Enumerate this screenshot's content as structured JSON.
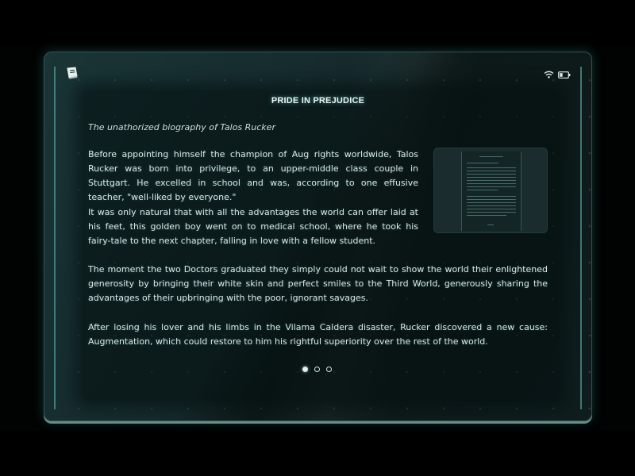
{
  "book": {
    "title": "PRIDE IN PREJUDICE",
    "subtitle": "The unathorized biography of Talos Rucker",
    "paragraphs": [
      "Before appointing himself the champion of Aug rights worldwide, Talos Rucker was born into privilege, to an upper-middle class couple in Stuttgart. He excelled in school and was, according to one effusive teacher, \"well-liked by everyone.\"",
      "It was only natural that with all the advantages the world can offer laid at his feet, this golden boy went on to medical school, where he took his fairy-tale to the next chapter, falling in love with a fellow student.",
      "The moment the two Doctors graduated they simply could not wait to show the world their enlightened generosity by bringing their white skin and perfect smiles to the Third World, generously sharing the advantages of their upbringing with the poor, ignorant savages.",
      "After losing his lover and his limbs in the Vilama Caldera disaster, Rucker discovered a new cause: Augmentation, which could restore to him his rightful superiority over the rest of the world."
    ]
  },
  "status_bar": {
    "icons": [
      "wifi-icon",
      "battery-icon"
    ]
  },
  "header": {
    "icon": "book-icon"
  },
  "pagination": {
    "total_pages": 3,
    "current_page": 1
  },
  "colors": {
    "accent": "#4f8e8e",
    "text": "#d7e6e5",
    "background": "#15292b"
  }
}
